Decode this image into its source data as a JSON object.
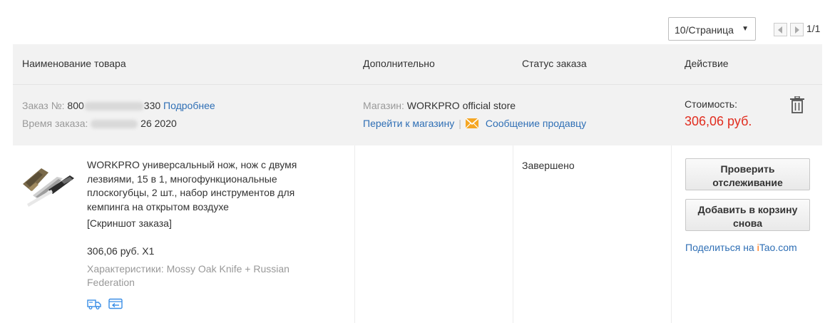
{
  "pagination": {
    "per_page": "10/Страница",
    "page_count": "1/1"
  },
  "table_header": {
    "product": "Наименование товара",
    "extra": "Дополнительно",
    "status": "Статус заказа",
    "action": "Действие"
  },
  "order": {
    "number_label": "Заказ №:",
    "number_prefix": "800",
    "number_suffix": "330",
    "details_link": "Подробнее",
    "time_label": "Время заказа:",
    "time_value": "26 2020",
    "store_label": "Магазин:",
    "store_name": "WORKPRO official store",
    "go_to_store": "Перейти к магазину",
    "separator": "|",
    "message_seller": "Сообщение продавцу",
    "cost_label": "Стоимость:",
    "cost_value": "306,06 руб."
  },
  "product": {
    "title": "WORKPRO универсальный нож, нож с двумя лезвиями, 15 в 1, многофункциональные плоскогубцы, 2 шт., набор инструментов для кемпинга на открытом воздухе",
    "snapshot": "[Скриншот заказа]",
    "price_qty": "306,06 руб. X1",
    "attributes": "Характеристики: Mossy Oak Knife + Russian Federation",
    "status": "Завершено"
  },
  "actions": {
    "track": "Проверить отслеживание",
    "reorder": "Добавить в корзину снова",
    "share_prefix": "Поделиться на ",
    "share_brand_i": "i",
    "share_brand_rest": "Tao.com"
  },
  "icons": {
    "delete": "trash-icon",
    "mail": "envelope-icon",
    "shipping": "truck-icon",
    "return": "return-icon"
  },
  "colors": {
    "price": "#e12d1f",
    "link": "#2f6fb5",
    "mail": "#f5a623",
    "brand_i": "#ff6a00",
    "service_icon": "#3a8ee6"
  }
}
